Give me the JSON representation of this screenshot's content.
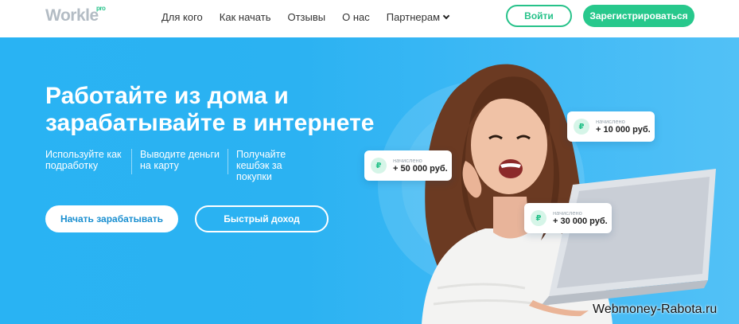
{
  "header": {
    "logo": "Workle",
    "logo_badge": "pro",
    "nav": [
      {
        "label": "Для кого"
      },
      {
        "label": "Как начать"
      },
      {
        "label": "Отзывы"
      },
      {
        "label": "О нас"
      },
      {
        "label": "Партнерам"
      }
    ],
    "login_label": "Войти",
    "register_label": "Зарегистрироваться"
  },
  "hero": {
    "title": "Работайте из дома и зарабатывайте в интернете",
    "features": [
      {
        "text": "Используйте как подработку"
      },
      {
        "text": "Выводите деньги на карту"
      },
      {
        "text": "Получайте кешбэк за покупки"
      }
    ],
    "primary_cta": "Начать зарабатывать",
    "secondary_cta": "Быстрый доход"
  },
  "cards": [
    {
      "label": "начислено",
      "amount": "+ 50 000 руб.",
      "icon": "ruble-icon"
    },
    {
      "label": "начислено",
      "amount": "+ 10 000 руб.",
      "icon": "ruble-icon"
    },
    {
      "label": "начислено",
      "amount": "+ 30 000 руб.",
      "icon": "ruble-icon"
    }
  ],
  "currency_symbol": "₽",
  "watermark": "Webmoney-Rabota.ru",
  "colors": {
    "brand_green": "#27c28a",
    "hero_blue": "#29b3f3"
  }
}
